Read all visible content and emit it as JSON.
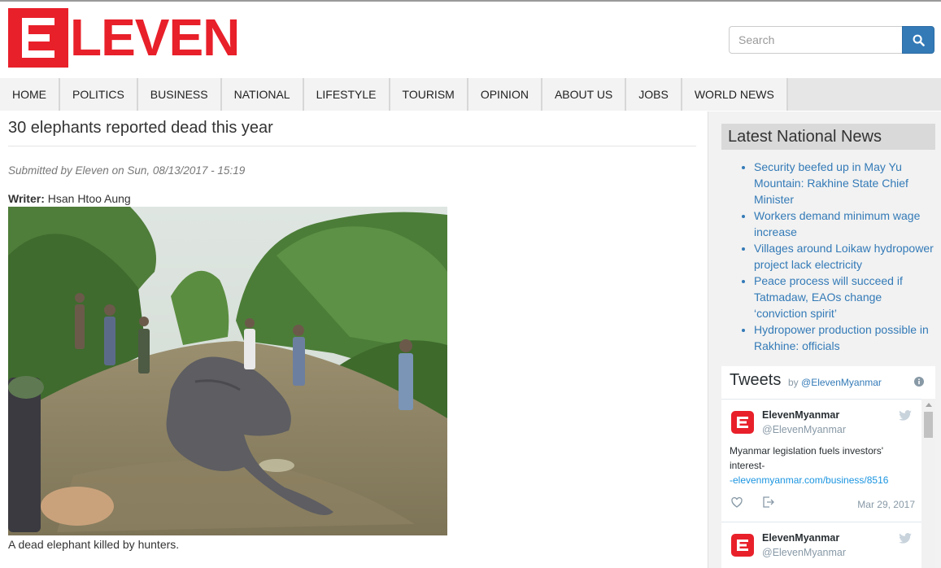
{
  "header": {
    "logo_text": "LEVEN",
    "search": {
      "placeholder": "Search"
    }
  },
  "nav": {
    "items": [
      "HOME",
      "POLITICS",
      "BUSINESS",
      "NATIONAL",
      "LIFESTYLE",
      "TOURISM",
      "OPINION",
      "ABOUT US",
      "JOBS",
      "WORLD NEWS"
    ]
  },
  "article": {
    "title": "30 elephants reported dead this year",
    "submitted": "Submitted by Eleven on Sun, 08/13/2017 - 15:19",
    "writer_label": "Writer:",
    "writer_name": "Hsan Htoo Aung",
    "caption": "A dead elephant killed by hunters."
  },
  "sidebar": {
    "latest_title": "Latest National News",
    "latest_items": [
      "Security beefed up in May Yu Mountain: Rakhine State Chief Minister",
      "Workers demand minimum wage increase",
      "Villages around Loikaw hydropower project lack electricity",
      "Peace process will succeed if Tatmadaw, EAOs change ‘conviction spirit’",
      "Hydropower production possible in Rakhine: officials"
    ],
    "tweets": {
      "title": "Tweets",
      "by": "by",
      "handle_link": "@ElevenMyanmar",
      "items": [
        {
          "name": "ElevenMyanmar",
          "handle": "@ElevenMyanmar",
          "text": "Myanmar legislation fuels investors' interest-",
          "link": "-elevenmyanmar.com/business/8516",
          "date": "Mar 29, 2017"
        },
        {
          "name": "ElevenMyanmar",
          "handle": "@ElevenMyanmar"
        }
      ]
    }
  },
  "colors": {
    "brand_red": "#e8202a",
    "link_blue": "#337ab7",
    "search_blue": "#337ab7"
  }
}
